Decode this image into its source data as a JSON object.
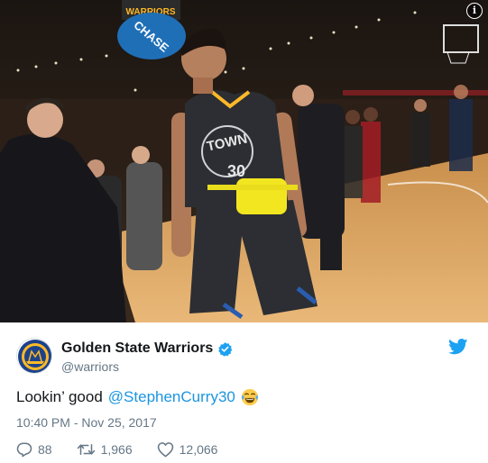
{
  "photo": {
    "alt_icons": {
      "info": "info-icon"
    },
    "banner_text": "WARRIORS",
    "scoreboard_sponsor": "CHASE",
    "jersey_text": "TOWN",
    "jersey_number": "30",
    "info_glyph": "i"
  },
  "tweet": {
    "author": {
      "display_name": "Golden State Warriors",
      "handle": "@warriors",
      "verified": true
    },
    "text": "Lookin’ good",
    "mention": "@StephenCurry30",
    "emoji": "face-with-tears-of-joy-icon",
    "timestamp": "10:40 PM - Nov 25, 2017",
    "stats": {
      "replies": "88",
      "retweets": "1,966",
      "likes": "12,066"
    }
  },
  "colors": {
    "link": "#1b95e0",
    "secondary_text": "#657786",
    "warriors_blue": "#1d428a",
    "warriors_gold": "#fdb927",
    "twitter_blue": "#1da1f2"
  }
}
